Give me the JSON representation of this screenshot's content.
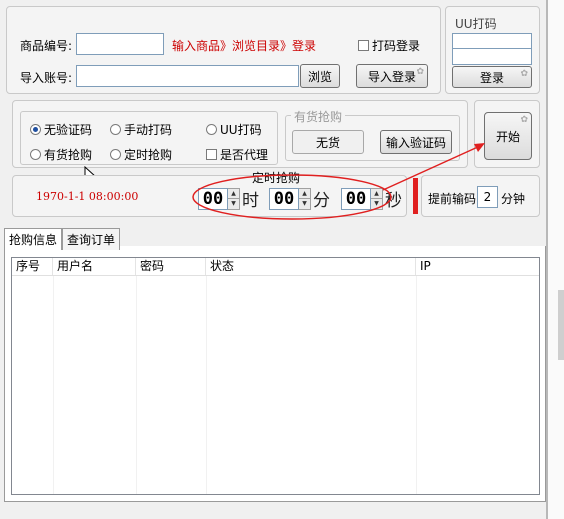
{
  "product": {
    "label": "商品编号:",
    "value": "",
    "link": "输入商品》浏览目录》登录",
    "captcha_login_label": "打码登录"
  },
  "account": {
    "label": "导入账号:",
    "value": "",
    "browse_button": "浏览",
    "import_login_button": "导入登录"
  },
  "uu_panel": {
    "title": "UU打码",
    "user_value": "",
    "password_value": "",
    "login_button": "登录"
  },
  "mode": {
    "no_captcha": "无验证码",
    "manual_captcha": "手动打码",
    "uu_captcha": "UU打码",
    "in_stock_grab": "有货抢购",
    "timed_grab": "定时抢购",
    "is_proxy": "是否代理"
  },
  "stock_group": {
    "title": "有货抢购",
    "no_stock_button": "无货",
    "input_captcha_button": "输入验证码"
  },
  "start_button": "开始",
  "timer": {
    "title": "定时抢购",
    "datetime": "1970-1-1 08:00:00",
    "hour": "00",
    "hour_unit": "时",
    "minute": "00",
    "minute_unit": "分",
    "second": "00",
    "second_unit": "秒"
  },
  "advance": {
    "prefix": "提前输码",
    "value": "2",
    "suffix": "分钟"
  },
  "tabs": [
    "抢购信息",
    "查询订单"
  ],
  "table": {
    "columns": [
      "序号",
      "用户名",
      "密码",
      "状态",
      "IP"
    ]
  },
  "colors": {
    "accent_red": "#cc0000",
    "annotation_red": "#e02020"
  }
}
